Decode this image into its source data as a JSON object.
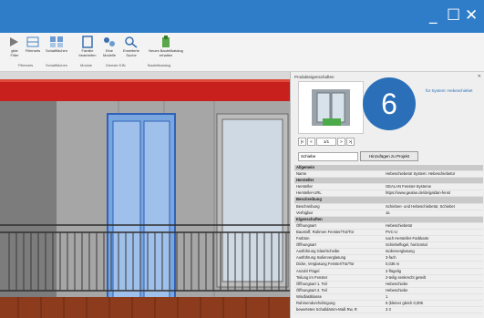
{
  "window": {
    "minimize_icon": "_",
    "maximize_icon": "☐",
    "close_icon": "✕"
  },
  "ribbon": {
    "buttons": [
      {
        "label": "gkte\nFilter",
        "icon": "select-icon"
      },
      {
        "label": "Filtersets",
        "icon": "filter-icon"
      },
      {
        "label": "Schaltflächen",
        "icon": "buttons-icon"
      },
      {
        "label": "Familie\nbearbeiten",
        "icon": "family-icon"
      },
      {
        "label": "Eine\nModelle",
        "icon": "model-icon"
      },
      {
        "label": "Erweiterte\nSuche",
        "icon": "search-icon"
      },
      {
        "label": "Neues Bauteilkatalog\nerhalten",
        "icon": "catalog-icon"
      }
    ],
    "groups": [
      "Filtersets",
      "Schaltflächen",
      "Module",
      "Dienste DIN",
      "Bauteilkatalog"
    ]
  },
  "panel": {
    "title": "Produkteigenschaften",
    "close": "✕",
    "system_link": "für System: Hebeschiebet",
    "badge": "6",
    "pager": {
      "first": "|<",
      "prev": "<",
      "page": "1/1",
      "next": ">",
      "last": ">|"
    },
    "select_value": "Schiebe",
    "add_button": "Hinzufügen zu Projekt",
    "rows": [
      {
        "type": "sec",
        "k": "Allgemein",
        "v": ""
      },
      {
        "type": "row",
        "k": "Name",
        "v": "Hebeschiebetür System: Hebeschiebetür"
      },
      {
        "type": "sec",
        "k": "Hersteller",
        "v": ""
      },
      {
        "type": "row",
        "k": "Hersteller",
        "v": "GEALAN Fenster-Systeme"
      },
      {
        "type": "row",
        "k": "Hersteller-URL",
        "v": "https://www.gealan.de/de/galdan-fenst"
      },
      {
        "type": "sec",
        "k": "Beschreibung",
        "v": ""
      },
      {
        "type": "row",
        "k": "Beschreibung",
        "v": "Schieben- und Hebeschiebetür, Schiebet"
      },
      {
        "type": "row",
        "k": "Verfügbar",
        "v": "Ja"
      },
      {
        "type": "sec",
        "k": "Eigenschaften",
        "v": ""
      },
      {
        "type": "row",
        "k": "Öffnungsart",
        "v": "Hebeschiebetür"
      },
      {
        "type": "row",
        "k": "Baustoff, Rahmen Fenster/Tür/Tor",
        "v": "PVC-U"
      },
      {
        "type": "row",
        "k": "Farbton",
        "v": "nach Hersteller-Farbkarte"
      },
      {
        "type": "row",
        "k": "Öffnungsart",
        "v": "Schiebeflügel, horizontal"
      },
      {
        "type": "row",
        "k": "Ausführung Glas/Scheibe",
        "v": "Isolierverglasung"
      },
      {
        "type": "row",
        "k": "Ausführung Isolierverglasung",
        "v": "3-fach"
      },
      {
        "type": "row",
        "k": "Dicke, Verglasung Fenster/Tür/Tor",
        "v": "0,036 m"
      },
      {
        "type": "row",
        "k": "Anzahl Flügel",
        "v": "2-flügelig"
      },
      {
        "type": "row",
        "k": "Teilung im Fenster",
        "v": "2-teilig senkrecht geteilt"
      },
      {
        "type": "row",
        "k": "Öffnungsart 1. Teil",
        "v": "Hebeschiebe"
      },
      {
        "type": "row",
        "k": "Öffnungsart 2. Teil",
        "v": "Hebeschiebe"
      },
      {
        "type": "row",
        "k": "Windlastklasse",
        "v": "1"
      },
      {
        "type": "row",
        "k": "Rahmendurchdringung",
        "v": "6 (kleiner gleich 0,006"
      },
      {
        "type": "row",
        "k": "bewertetes Schalldämm-Maß Rw, R",
        "v": "3 3"
      }
    ]
  }
}
